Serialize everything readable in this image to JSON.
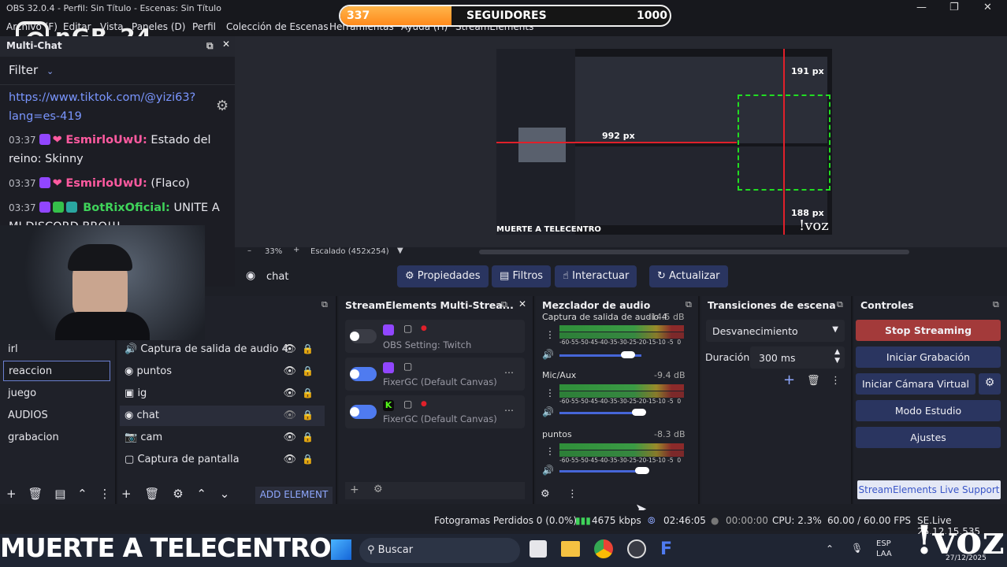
{
  "window": {
    "title": "OBS 32.0.4 - Perfil: Sin Título - Escenas: Sin Título"
  },
  "menu": [
    "Archivo (F)",
    "Editar",
    "Vista",
    "Paneles (D)",
    "Perfil",
    "Colección de Escenas",
    "Herramientas",
    "Ayuda (H)",
    "StreamElements"
  ],
  "overlay": {
    "logo_text": "nGB_24",
    "goal_current": "337",
    "goal_label": "SEGUIDORES",
    "goal_target": "1000",
    "goal_progress": 0.337,
    "bottom_text": "MUERTE A TELECENTRO",
    "voz": "!voz"
  },
  "multichat": {
    "title": "Multi-Chat",
    "filter": "Filter",
    "link": "https://www.tiktok.com/@yizi63?lang=es-419",
    "messages": [
      {
        "time": "03:37",
        "user": "EsmirloUwU:",
        "text": "Estado del reino: Skinny"
      },
      {
        "time": "03:37",
        "user": "EsmirloUwU:",
        "text": "(Flaco)"
      },
      {
        "time": "03:37",
        "user": "BotRixOficial:",
        "text": "UNITE A MI DISCORD BRO!!!"
      }
    ]
  },
  "preview": {
    "zoom": "33%",
    "scale": "Escalado (452x254)",
    "m1": "191 px",
    "m2": "992 px",
    "m3": "188 px"
  },
  "source_bar": {
    "name": "chat",
    "properties": "Propiedades",
    "filters": "Filtros",
    "interact": "Interactuar",
    "refresh": "Actualizar"
  },
  "scenes": [
    "irl",
    "reaccion",
    "juego",
    "AUDIOS",
    "grabacion"
  ],
  "sources": [
    "Captura de salida de audio 4",
    "puntos",
    "ig",
    "chat",
    "cam",
    "Captura de pantalla"
  ],
  "se_multistream": {
    "title": "StreamElements Multi-Strea...",
    "items": [
      {
        "label": "OBS Setting: Twitch"
      },
      {
        "label": "FixerGC (Default Canvas)"
      },
      {
        "label": "FixerGC (Default Canvas)"
      }
    ],
    "add_element": "ADD ELEMENT"
  },
  "mixer": {
    "title": "Mezclador de audio",
    "channels": [
      {
        "name": "Captura de salida de audio 4",
        "db": "-14.5 dB",
        "level": 0.42,
        "volume": 0.85
      },
      {
        "name": "Mic/Aux",
        "db": "-9.4 dB",
        "level": 0.55,
        "volume": 0.9
      },
      {
        "name": "puntos",
        "db": "-8.3 dB",
        "level": 0.42,
        "volume": 0.9
      }
    ],
    "scale": "-60-55-50-45-40-35-30-25-20-15-10 -5  0"
  },
  "transitions": {
    "title": "Transiciones de escena",
    "type": "Desvanecimiento",
    "duration_label": "Duración",
    "duration": "300 ms"
  },
  "controls": {
    "title": "Controles",
    "stop_streaming": "Stop Streaming",
    "record": "Iniciar Grabación",
    "virtual_cam": "Iniciar Cámara Virtual",
    "studio": "Modo Estudio",
    "settings": "Ajustes",
    "support": "StreamElements Live Support"
  },
  "status": {
    "dropped": "Fotogramas Perdidos 0 (0.0%)",
    "bitrate": "4675 kbps",
    "live_time": "02:46:05",
    "rec_time": "00:00:00",
    "cpu": "CPU: 2.3%",
    "fps": "60.00 / 60.00 FPS",
    "se": "SE.Live 25.12.15.535"
  },
  "taskbar": {
    "search": "Buscar",
    "lang1": "ESP",
    "lang2": "LAA",
    "date": "27/12/2025"
  },
  "colors": {
    "accent_button": "#2a3560",
    "stop_button": "#a33a3a",
    "twitch": "#9146ff",
    "kick": "#53fc18",
    "goal_fill": "#ff9a2e"
  }
}
